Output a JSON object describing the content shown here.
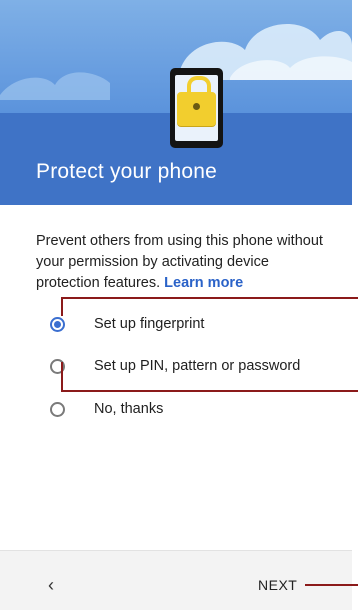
{
  "header": {
    "title": "Protect your phone",
    "illustration": "phone-lock-icon",
    "bg_color": "#3f73c6"
  },
  "body": {
    "description": "Prevent others from using this phone without your permission by activating device protection features.",
    "learn_more": "Learn more",
    "link_color": "#2a62c8"
  },
  "options": [
    {
      "label": "Set up fingerprint",
      "selected": true
    },
    {
      "label": "Set up PIN, pattern or password",
      "selected": false
    },
    {
      "label": "No, thanks",
      "selected": false
    }
  ],
  "nav": {
    "back_icon": "chevron-left-icon",
    "back_glyph": "‹",
    "next_label": "NEXT"
  },
  "callout_color": "#8b1a1a"
}
